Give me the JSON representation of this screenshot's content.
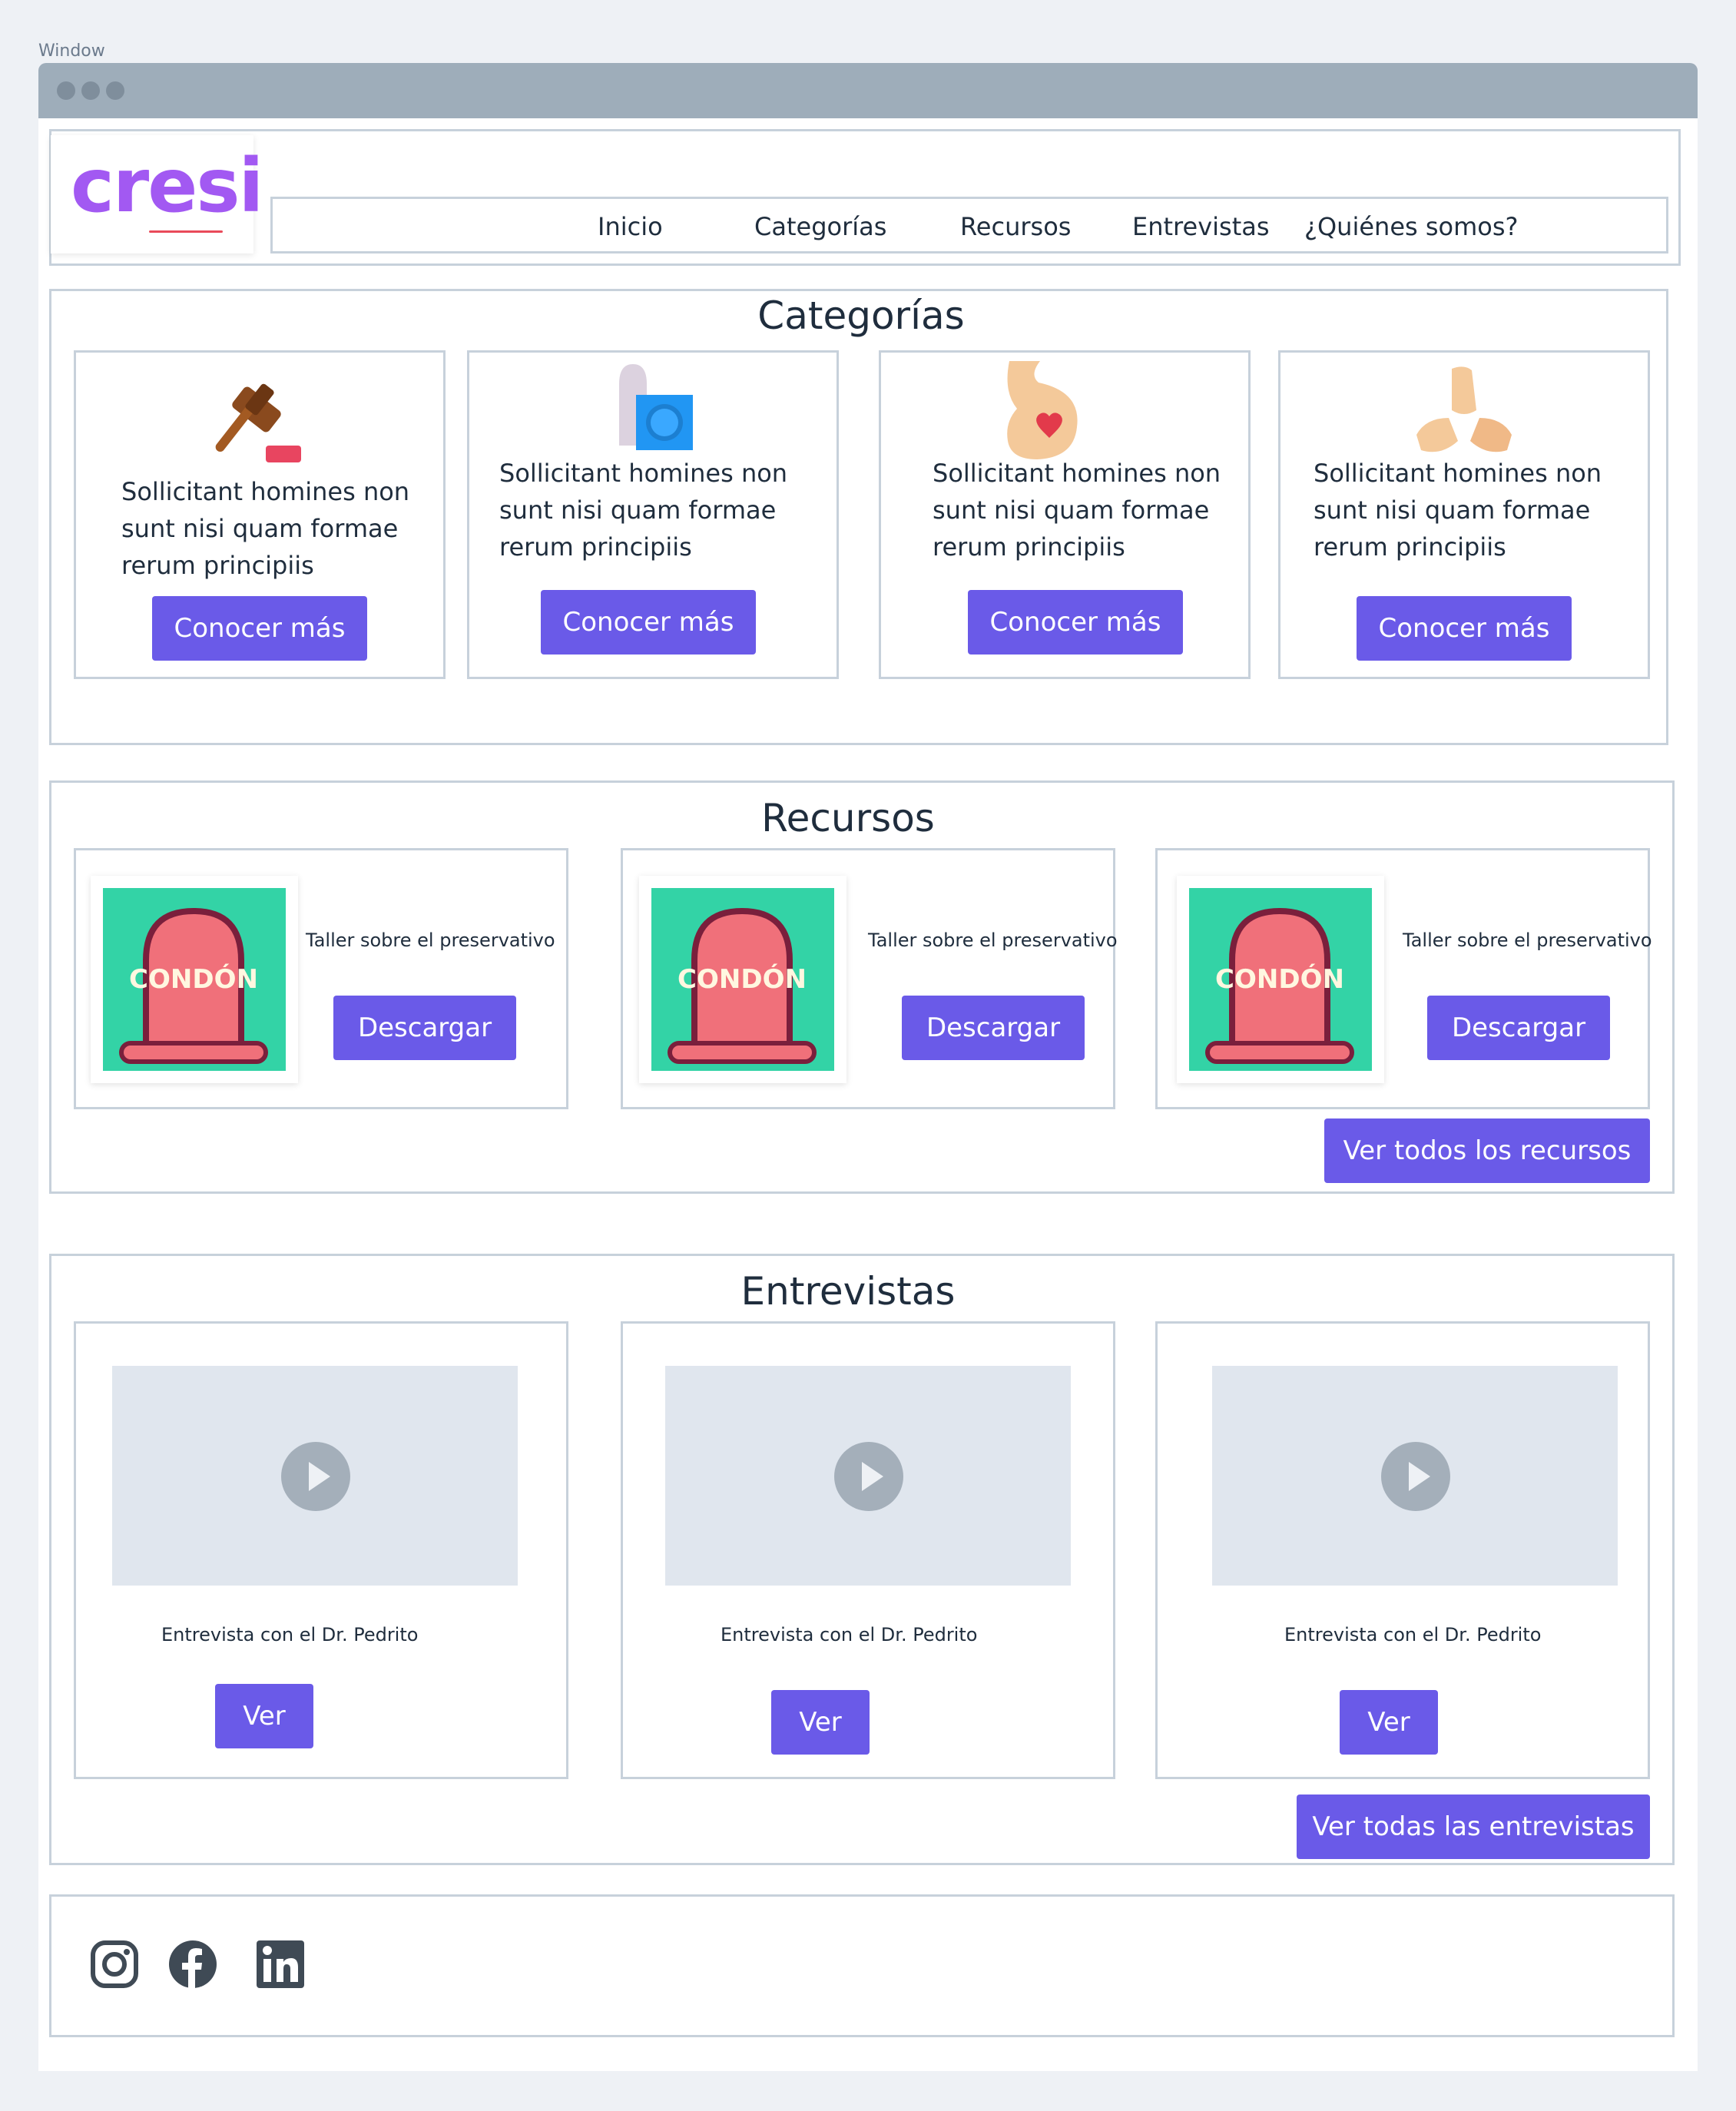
{
  "window": {
    "label": "Window"
  },
  "logo": {
    "text": "cresi"
  },
  "nav": [
    "Inicio",
    "Categorías",
    "Recursos",
    "Entrevistas",
    "¿Quiénes somos?"
  ],
  "categorias": {
    "title": "Categorías",
    "cards": [
      {
        "icon": "gavel-icon",
        "text": [
          "Sollicitant homines non",
          "sunt nisi quam formae",
          "rerum principiis"
        ],
        "button": "Conocer más"
      },
      {
        "icon": "condom-icon",
        "text": [
          "Sollicitant homines non",
          "sunt nisi quam formae",
          "rerum principiis"
        ],
        "button": "Conocer más"
      },
      {
        "icon": "pregnancy-icon",
        "text": [
          "Sollicitant homines non",
          "sunt nisi quam formae",
          "rerum principiis"
        ],
        "button": "Conocer más"
      },
      {
        "icon": "hands-icon",
        "text": [
          "Sollicitant homines non",
          "sunt nisi quam formae",
          "rerum principiis"
        ],
        "button": "Conocer más"
      }
    ]
  },
  "recursos": {
    "title": "Recursos",
    "items": [
      {
        "label": "Taller sobre el preservativo",
        "button": "Descargar",
        "poster_text": "CONDÓN"
      },
      {
        "label": "Taller sobre el preservativo",
        "button": "Descargar",
        "poster_text": "CONDÓN"
      },
      {
        "label": "Taller sobre el preservativo",
        "button": "Descargar",
        "poster_text": "CONDÓN"
      }
    ],
    "view_all": "Ver todos los recursos"
  },
  "entrevistas": {
    "title": "Entrevistas",
    "items": [
      {
        "label": "Entrevista con el Dr. Pedrito",
        "button": "Ver"
      },
      {
        "label": "Entrevista con el Dr. Pedrito",
        "button": "Ver"
      },
      {
        "label": "Entrevista con el Dr. Pedrito",
        "button": "Ver"
      }
    ],
    "view_all": "Ver todas las entrevistas"
  },
  "footer": {
    "social": [
      "instagram-icon",
      "facebook-icon",
      "linkedin-icon"
    ]
  },
  "colors": {
    "accent": "#6a5ae8",
    "logo": "#a259f2",
    "border": "#c7d1db",
    "poster_bg": "#33d3a6"
  }
}
